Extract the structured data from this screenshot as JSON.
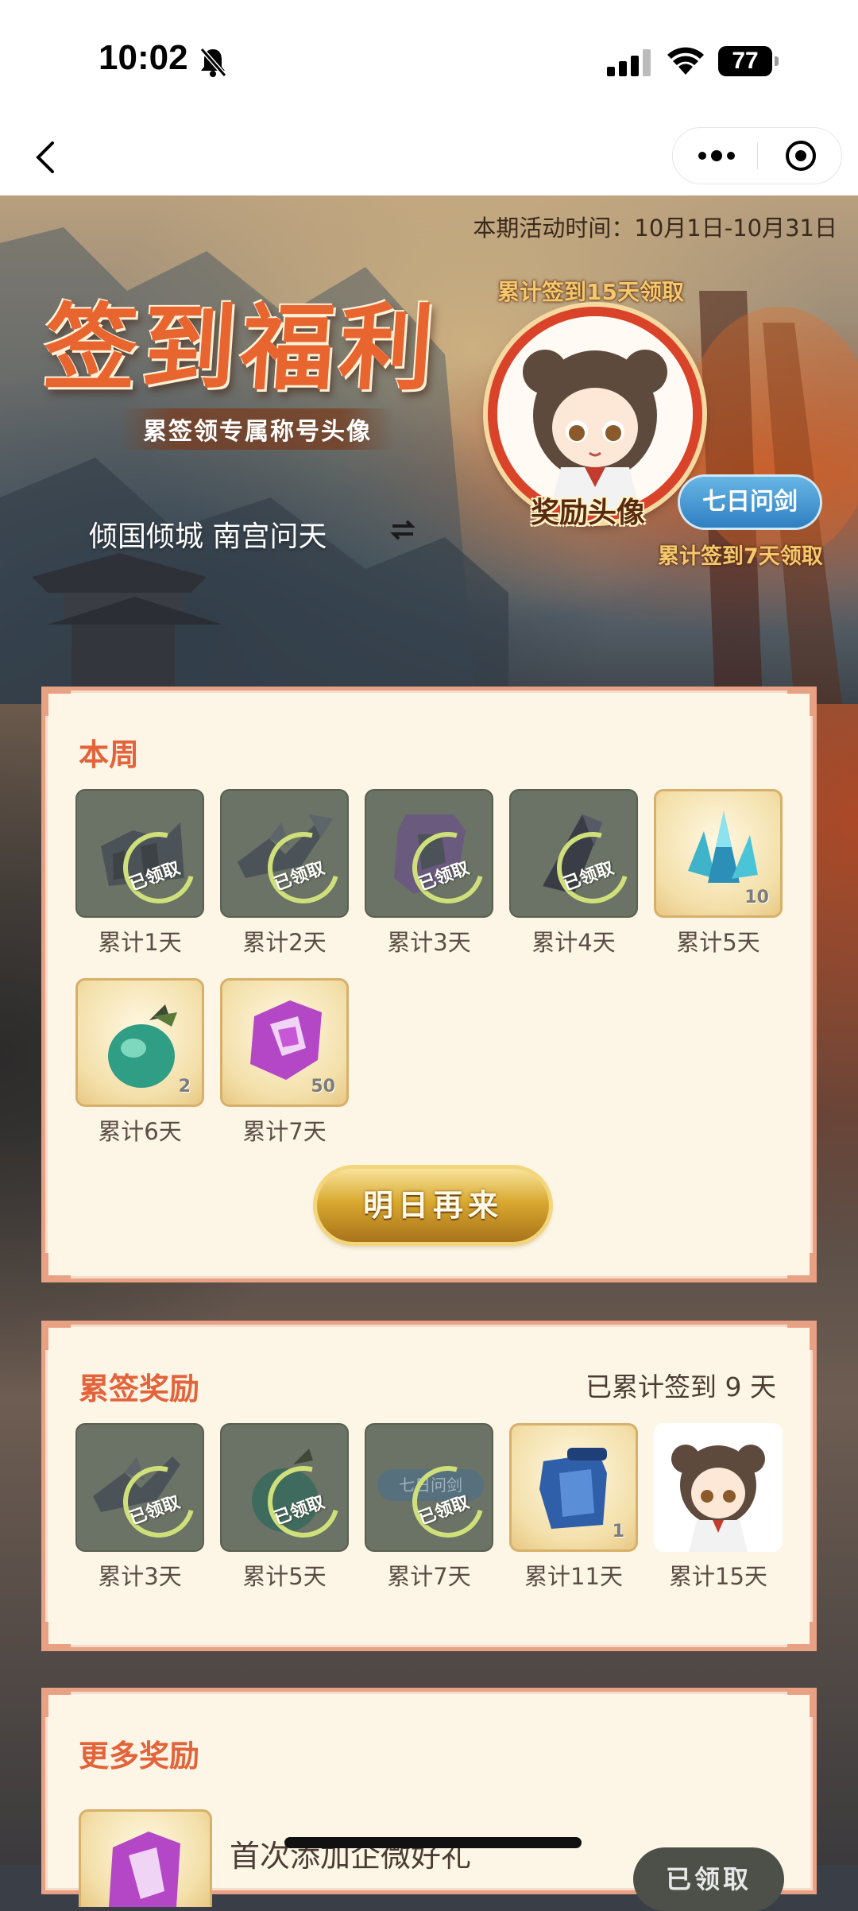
{
  "status_bar": {
    "time": "10:02",
    "battery": "77"
  },
  "banner": {
    "activity_time": "本期活动时间：10月1日-10月31日",
    "title": "签到福利",
    "subtitle": "累签领专属称号头像",
    "username": "倾国倾城 南宫问天",
    "reward_hint_top": "累计签到15天领取",
    "reward_avatar_label": "奖励头像",
    "title_badge": "七日问剑",
    "reward_hint_bottom": "累计签到7天领取"
  },
  "weekly": {
    "title": "本周",
    "claimed_text": "已领取",
    "items": [
      {
        "label": "累计1天",
        "status": "claimed",
        "icon": "ruined-wall-icon"
      },
      {
        "label": "累计2天",
        "status": "claimed",
        "icon": "broken-sword-icon"
      },
      {
        "label": "累计3天",
        "status": "claimed",
        "icon": "purple-token-icon"
      },
      {
        "label": "累计4天",
        "status": "claimed",
        "icon": "dark-shard-icon"
      },
      {
        "label": "累计5天",
        "status": "unclaimed",
        "icon": "blue-crystal-icon",
        "qty": "10"
      },
      {
        "label": "累计6天",
        "status": "unclaimed",
        "icon": "green-gourd-icon",
        "qty": "2"
      },
      {
        "label": "累计7天",
        "status": "unclaimed",
        "icon": "purple-token-icon",
        "qty": "50"
      }
    ],
    "button": "明日再来"
  },
  "cumulative": {
    "title": "累签奖励",
    "status": "已累计签到 9 天",
    "claimed_text": "已领取",
    "items": [
      {
        "label": "累计3天",
        "status": "claimed",
        "icon": "broken-sword-icon"
      },
      {
        "label": "累计5天",
        "status": "claimed",
        "icon": "green-gourd-icon"
      },
      {
        "label": "累计7天",
        "status": "claimed",
        "icon": "title-badge-icon",
        "badge_text": "七日问剑"
      },
      {
        "label": "累计11天",
        "status": "unclaimed",
        "icon": "blue-scroll-icon",
        "qty": "1"
      },
      {
        "label": "累计15天",
        "status": "plain",
        "icon": "chibi-avatar-icon"
      }
    ]
  },
  "more": {
    "title": "更多奖励",
    "item_text": "首次添加企微好礼",
    "item_button": "已领取"
  },
  "colors": {
    "accent": "#e3633b",
    "panel_bg": "#fdf6e6",
    "panel_border": "#e9a184",
    "gold_button": "#d9a930",
    "badge_blue": "#2f7fc2"
  }
}
